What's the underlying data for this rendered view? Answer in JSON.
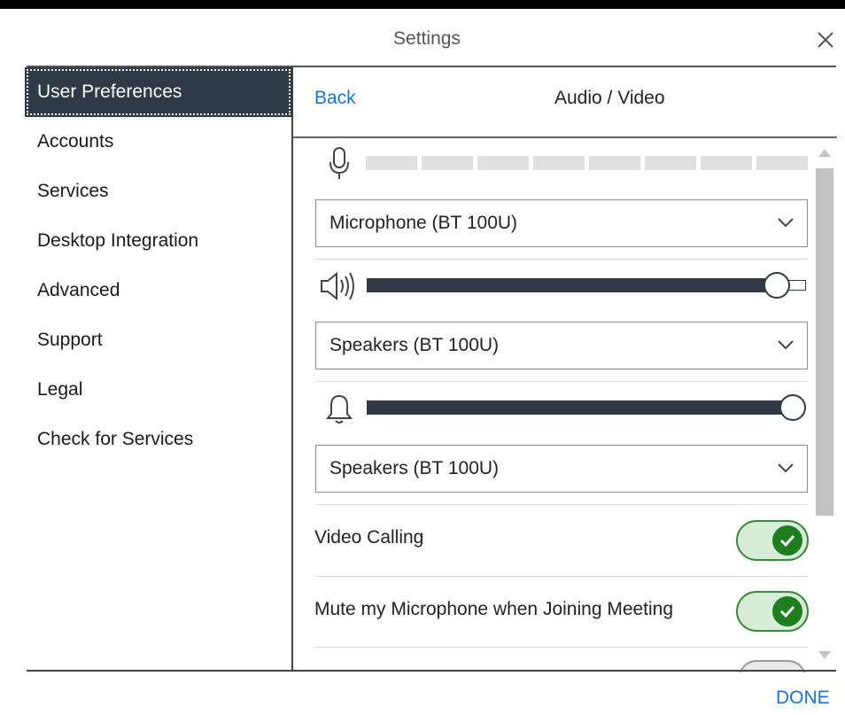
{
  "dialog": {
    "title": "Settings"
  },
  "sidebar": {
    "selected": "User Preferences",
    "items": [
      "Accounts",
      "Services",
      "Desktop Integration",
      "Advanced",
      "Support",
      "Legal",
      "Check for Services"
    ]
  },
  "panel": {
    "back_label": "Back",
    "title": "Audio / Video",
    "microphone_select": "Microphone (BT 100U)",
    "speaker_select": "Speakers (BT 100U)",
    "ringer_select": "Speakers (BT 100U)",
    "speaker_volume_fraction": 0.95,
    "ringer_volume_fraction": 1.0,
    "video_calling_label": "Video Calling",
    "video_calling_on": true,
    "mute_on_join_label": "Mute my Microphone when Joining Meeting",
    "mute_on_join_on": true
  },
  "footer": {
    "done_label": "DONE"
  },
  "icons": [
    "close-icon",
    "microphone-icon",
    "speaker-icon",
    "bell-icon",
    "chevron-down-icon",
    "check-icon"
  ],
  "colors": {
    "link": "#1a73d9",
    "selected_bg": "#2f3a46",
    "toggle_on": "#1e7d1e"
  }
}
